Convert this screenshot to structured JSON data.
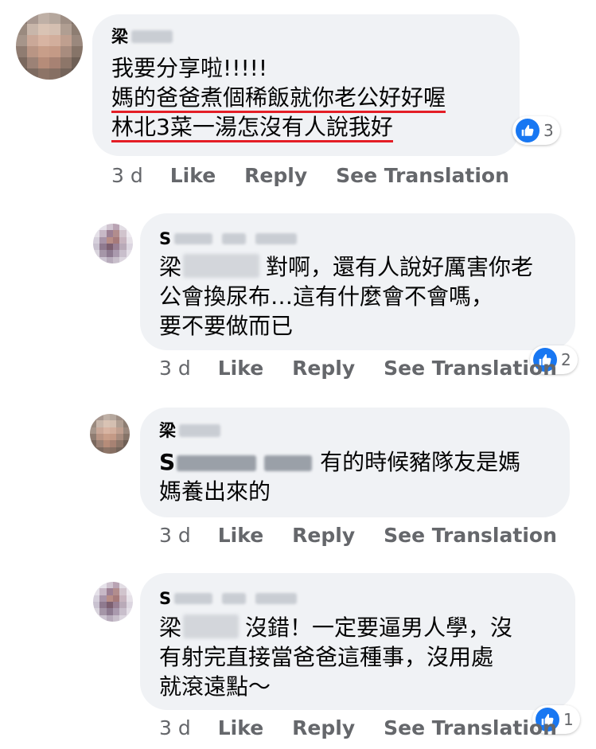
{
  "comments": [
    {
      "author_initial": "梁",
      "lines": [
        "我要分享啦!!!!!",
        "媽的爸爸煮個稀飯就你老公好好喔",
        "林北3菜一湯怎沒有人說我好"
      ],
      "age": "3 d",
      "actions": [
        "Like",
        "Reply",
        "See Translation"
      ],
      "reaction_count": "3"
    },
    {
      "author_initial": "S",
      "mention_initial": "梁",
      "lines": [
        "對啊，還有人說好厲害你老",
        "公會換尿布…這有什麼會不會嗎，",
        "要不要做而已"
      ],
      "age": "3 d",
      "actions": [
        "Like",
        "Reply",
        "See Translation"
      ],
      "reaction_count": "2"
    },
    {
      "author_initial": "梁",
      "mention_initial": "S",
      "lines": [
        "有的時候豬隊友是媽",
        "媽養出來的"
      ],
      "age": "3 d",
      "actions": [
        "Like",
        "Reply",
        "See Translation"
      ]
    },
    {
      "author_initial": "S",
      "mention_initial": "梁",
      "lines": [
        "沒錯！一定要逼男人學，沒",
        "有射完直接當爸爸這種事，沒用處",
        "就滾遠點～"
      ],
      "age": "3 d",
      "actions": [
        "Like",
        "Reply",
        "See Translation"
      ],
      "reaction_count": "1"
    }
  ],
  "colors": {
    "bubble": "#f0f2f5",
    "meta_text": "#65676b",
    "like_blue": "#1877f2",
    "underline_red": "#e41e26"
  },
  "icons": {
    "reaction": "thumbs-up-icon"
  }
}
